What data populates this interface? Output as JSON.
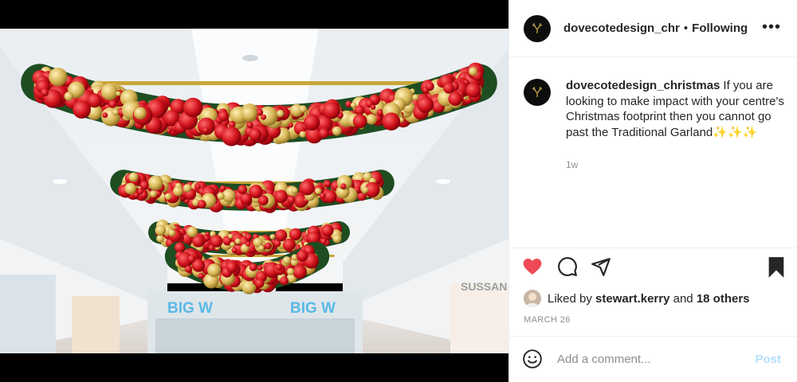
{
  "post": {
    "image_alt": "Christmas garlands hanging in shopping centre"
  },
  "header": {
    "username": "dovecotedesign_chr",
    "separator": "•",
    "follow_label": "Following",
    "more_label": "•••"
  },
  "caption": {
    "username": "dovecotedesign_christmas",
    "text": "If you are looking to make impact with your centre's Christmas footprint then you cannot go past the Traditional Garland✨✨✨",
    "time": "1w"
  },
  "engagement": {
    "liked_by_prefix": "Liked by",
    "liked_by_user": "stewart.kerry",
    "liked_by_join": "and",
    "others": "18 others",
    "date": "MARCH 26"
  },
  "comment_box": {
    "placeholder": "Add a comment...",
    "post_label": "Post"
  },
  "photo_signs": {
    "store_left": "BIG W",
    "store_right": "BIG W",
    "store_far_right": "SUSSAN"
  },
  "icons": {
    "like": "heart-filled-icon",
    "comment": "comment-icon",
    "share": "send-icon",
    "save": "bookmark-filled-icon",
    "emoji": "smiley-icon"
  },
  "colors": {
    "heart": "#ed4956",
    "post_disabled": "#b2dffc",
    "muted": "#8e8e8e"
  }
}
